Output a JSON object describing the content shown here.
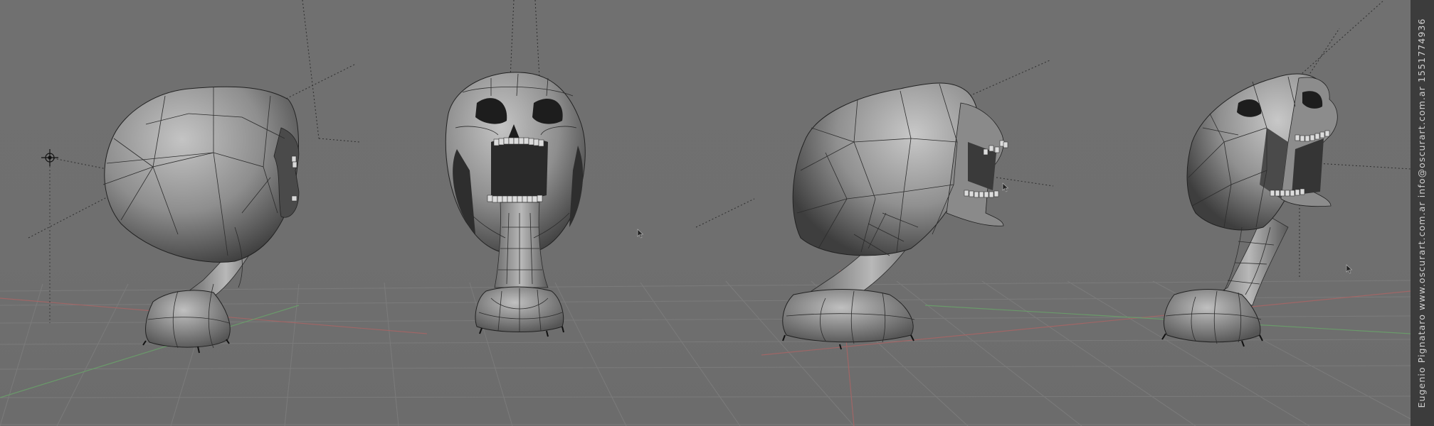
{
  "viewport": {
    "background": "#707070",
    "grid_color": "#868686",
    "axis_x_color": "#b06060",
    "axis_z_color": "#5f9f5f"
  },
  "model": {
    "name": "skull-on-stalk",
    "shade": "#9a9a9a",
    "wire": "#2a2a2a",
    "views": [
      "side-left",
      "front",
      "side-right",
      "three-quarter"
    ]
  },
  "credit": {
    "text": "Eugenio Pignataro www.oscurart.com.ar info@oscurart.com.ar 1551774936"
  },
  "icons": [
    "mouse-cursor-icon",
    "3d-cursor-icon"
  ]
}
